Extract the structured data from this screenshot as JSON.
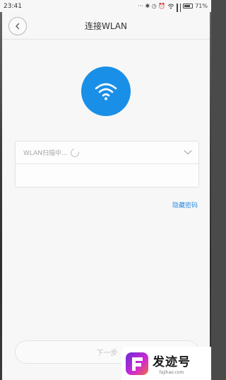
{
  "status_bar": {
    "time": "23:41",
    "indicators": "··· ✱ ⊙ ⏰ 🛜",
    "battery_text": "71%"
  },
  "header": {
    "title": "连接WLAN"
  },
  "wifi_icon": "wifi-icon",
  "network_field": {
    "placeholder": "WLAN扫描中..."
  },
  "password_field": {
    "value": ""
  },
  "hide_password_link": "隐藏密码",
  "next_button_label": "下一步",
  "watermark": {
    "title": "发迹号",
    "subtitle": "fajihao.com"
  },
  "colors": {
    "accent": "#1a8fe8",
    "link": "#2d8de3"
  }
}
